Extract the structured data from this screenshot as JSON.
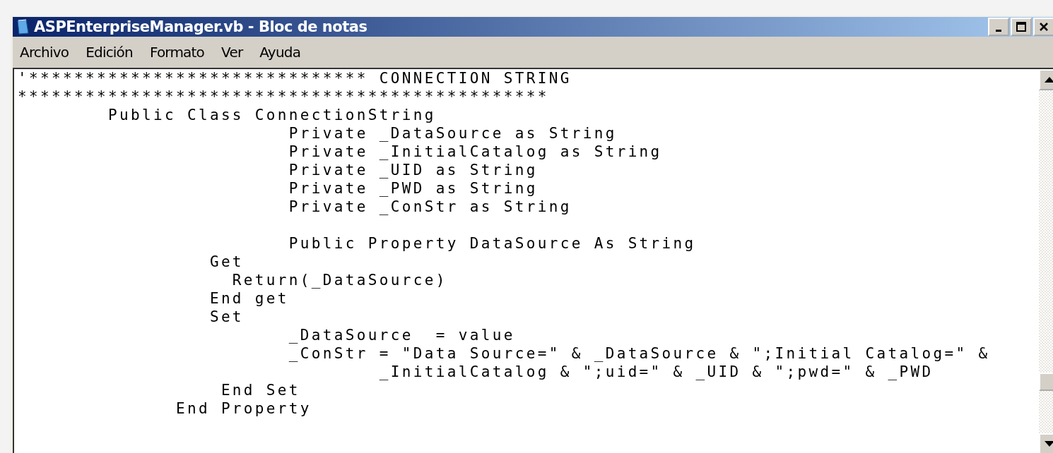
{
  "window": {
    "title": "ASPEnterpriseManager.vb - Bloc de notas"
  },
  "menu": [
    "Archivo",
    "Edición",
    "Formato",
    "Ver",
    "Ayuda"
  ],
  "editor": {
    "paragraphs": [
      [
        "'****************************** CONNECTION STRING",
        "***********************************************",
        "        Public Class ConnectionString",
        "                        Private _DataSource as String",
        "                        Private _InitialCatalog as String",
        "                        Private _UID as String",
        "                        Private _PWD as String",
        "                        Private _ConStr as String"
      ],
      [
        "                        Public Property DataSource As String",
        "                 Get",
        "                   Return(_DataSource)",
        "                 End get",
        "                 Set",
        "                        _DataSource  = value",
        "                        _ConStr = \"Data Source=\" & _DataSource & \";Initial Catalog=\" &",
        "                                _InitialCatalog & \";uid=\" & _UID & \";pwd=\" & _PWD",
        "                  End Set",
        "              End Property"
      ]
    ]
  }
}
